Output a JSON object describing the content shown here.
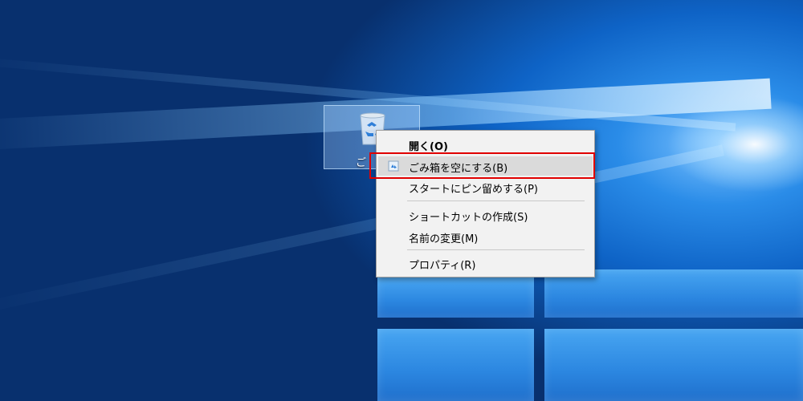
{
  "desktop": {
    "icon": {
      "name": "recycle-bin-icon",
      "label_visible": "ご"
    }
  },
  "context_menu": {
    "items": [
      {
        "label": "開く(O)",
        "bold": true
      },
      {
        "label": "ごみ箱を空にする(B)",
        "icon": "recycle-bin-small-icon",
        "highlighted": true
      },
      {
        "label": "スタートにピン留めする(P)"
      },
      {
        "label": "ショートカットの作成(S)"
      },
      {
        "label": "名前の変更(M)"
      },
      {
        "label": "プロパティ(R)"
      }
    ]
  },
  "colors": {
    "highlight_border": "#e00000",
    "menu_bg": "#f2f2f2",
    "accent_blue": "#1f6fcc"
  }
}
